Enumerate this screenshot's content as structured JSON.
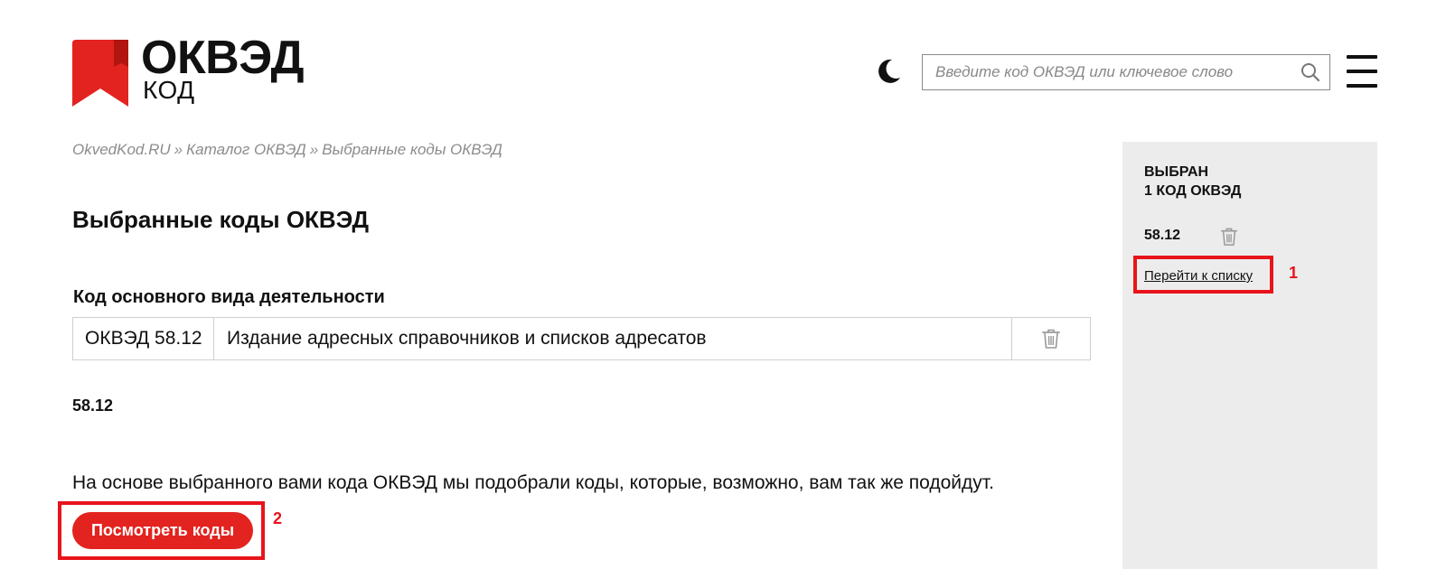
{
  "header": {
    "logo_title": "ОКВЭД",
    "logo_subtitle": "КОД",
    "search_placeholder": "Введите код ОКВЭД или ключевое слово",
    "icons": {
      "theme_toggle": "moon-icon",
      "search": "search-icon",
      "menu": "hamburger-menu-icon"
    }
  },
  "breadcrumb": {
    "items": [
      "OkvedKod.RU",
      "Каталог ОКВЭД",
      "Выбранные коды ОКВЭД"
    ],
    "separator": "»"
  },
  "main": {
    "title": "Выбранные коды ОКВЭД",
    "primary_section_label": "Код основного вида деятельности",
    "primary_row": {
      "code": "ОКВЭД 58.12",
      "name": "Издание адресных справочников и списков адресатов",
      "delete_icon": "trash-icon"
    },
    "selected_code": "58.12",
    "suggest_text": "На основе выбранного вами кода ОКВЭД мы подобрали коды, которые, возможно, вам так же подойдут.",
    "view_button_label": "Посмотреть коды"
  },
  "sidebar": {
    "heading_line1": "ВЫБРАН",
    "heading_line2": "1 КОД ОКВЭД",
    "code": "58.12",
    "delete_icon": "trash-icon",
    "go_to_list_label": "Перейти к списку"
  },
  "annotations": {
    "marker_1": "1",
    "marker_2": "2",
    "color": "#e8141b"
  },
  "colors": {
    "brand_red": "#e3231f",
    "sidebar_bg": "#ececec",
    "breadcrumb_text": "#8c8c8c"
  }
}
